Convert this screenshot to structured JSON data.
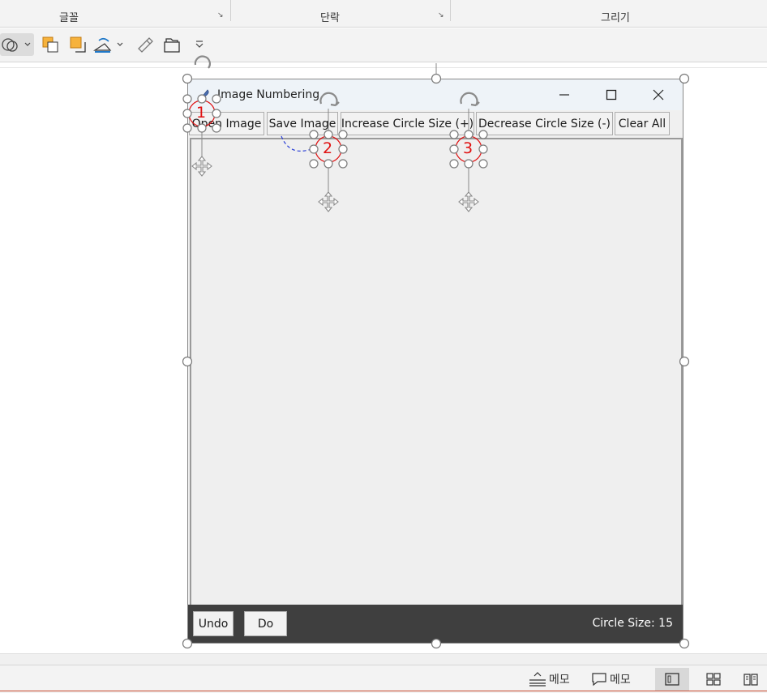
{
  "ribbon": {
    "groups": [
      {
        "label": "글꼴"
      },
      {
        "label": "단락"
      },
      {
        "label": "그리기"
      }
    ],
    "launcher_glyph": "↘"
  },
  "qat": {
    "icons": [
      "shapes-icon",
      "chevron-down-icon",
      "arrange-icon",
      "quick-styles-icon",
      "shape-fill-icon",
      "chevron-down-icon",
      "format-painter-icon",
      "select-icon",
      "more-icon"
    ]
  },
  "app": {
    "title": "Image Numbering",
    "controls": {
      "minimize": "—",
      "maximize": "☐",
      "close": "✕"
    },
    "toolbar": {
      "open_label": "Open Image",
      "save_label": "Save Image",
      "increase_label": "Increase Circle Size (+)",
      "decrease_label": "Decrease Circle Size (-)",
      "clear_label": "Clear All"
    },
    "markers": [
      "1",
      "2",
      "3"
    ],
    "bottom": {
      "undo_label": "Undo",
      "do_label": "Do",
      "circle_size_label": "Circle Size: 15"
    }
  },
  "status": {
    "notes_label": "메모",
    "comments_label": "메모"
  },
  "colors": {
    "marker_red": "#e01010",
    "handle_gray": "#7a7a7a",
    "bottombar": "#3f3f3f",
    "accent": "#c94b2f"
  }
}
